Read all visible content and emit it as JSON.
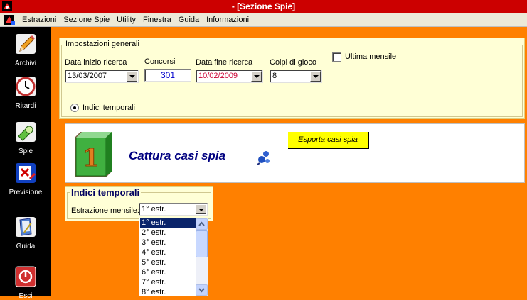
{
  "window": {
    "title": "- [Sezione Spie]"
  },
  "menubar": {
    "items": [
      "Estrazioni",
      "Sezione Spie",
      "Utility",
      "Finestra",
      "Guida",
      "Informazioni"
    ]
  },
  "sidebar": {
    "items": [
      {
        "label": "Archivi",
        "icon": "pencil-icon"
      },
      {
        "label": "Ritardi",
        "icon": "clock-icon"
      },
      {
        "label": "Spie",
        "icon": "flashlight-icon"
      },
      {
        "label": "Previsione",
        "icon": "prediction-icon"
      },
      {
        "label": "Guida",
        "icon": "book-icon"
      },
      {
        "label": "Esci",
        "icon": "exit-icon"
      }
    ]
  },
  "general": {
    "legend": "Impostazioni generali",
    "start_label": "Data inizio ricerca",
    "start_value": "13/03/2007",
    "concorsi_label": "Concorsi",
    "concorsi_value": "301",
    "end_label": "Data fine ricerca",
    "end_value": "10/02/2009",
    "colpi_label": "Colpi di gioco",
    "colpi_value": "8",
    "ultima_label": "Ultima mensile",
    "ultima_checked": false,
    "radio_label": "Indici temporali"
  },
  "banner": {
    "number": "1",
    "title": "Cattura casi spia",
    "export_label": "Esporta casi spia"
  },
  "indici": {
    "legend": "Indici temporali",
    "estrazione_label": "Estrazione mensile:",
    "estrazione_value": "1° estr.",
    "options": [
      "1° estr.",
      "2° estr.",
      "3° estr.",
      "4° estr.",
      "5° estr.",
      "6° estr.",
      "7° estr.",
      "8° estr."
    ],
    "selected_index": 0
  },
  "colors": {
    "background": "#ff8000",
    "titlebar": "#cc0000",
    "panel": "#ffffd6",
    "end_date": "#cc0033",
    "accent": "#000080"
  }
}
